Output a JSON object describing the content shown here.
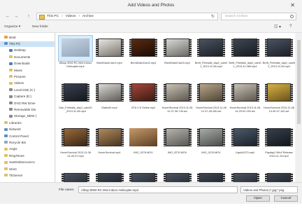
{
  "window": {
    "title": "Add Videos and Photos"
  },
  "nav": {
    "back": "←",
    "forward": "→",
    "up": "↑",
    "crumbs": [
      "This PC",
      "›",
      "Videos",
      "›",
      "Archive"
    ],
    "refresh": "↻",
    "search_placeholder": "Search Archive"
  },
  "toolbar": {
    "organize": "Organize ▾",
    "new_folder": "New folder",
    "view": "☷ ▾",
    "help": "?"
  },
  "tree": [
    {
      "label": "Brett",
      "indent": 0,
      "color": "#d9a441"
    },
    {
      "label": "This PC",
      "indent": 0,
      "color": "#5d8fc9",
      "selected": true
    },
    {
      "label": "Desktop",
      "indent": 1,
      "color": "#4b7fc0"
    },
    {
      "label": "Documents",
      "indent": 1,
      "color": "#e0c06a"
    },
    {
      "label": "Downloads",
      "indent": 1,
      "color": "#4b7fc0"
    },
    {
      "label": "Music",
      "indent": 1,
      "color": "#e0c06a"
    },
    {
      "label": "Pictures",
      "indent": 1,
      "color": "#e0c06a"
    },
    {
      "label": "Videos",
      "indent": 1,
      "color": "#e0c06a"
    },
    {
      "label": "Local Disk (C:)",
      "indent": 1,
      "color": "#8a8a8a"
    },
    {
      "label": "Capture (E:)",
      "indent": 1,
      "color": "#8a8a8a"
    },
    {
      "label": "DVD RW Drive",
      "indent": 1,
      "color": "#8a8a8a"
    },
    {
      "label": "Removable Dis",
      "indent": 1,
      "color": "#8a8a8a"
    },
    {
      "label": "Storage_NEW (",
      "indent": 1,
      "color": "#8a8a8a"
    },
    {
      "label": "Libraries",
      "indent": 0,
      "color": "#e0c06a"
    },
    {
      "label": "Network",
      "indent": 0,
      "color": "#5d8fc9"
    },
    {
      "label": "Control Panel",
      "indent": 0,
      "color": "#5d8fc9"
    },
    {
      "label": "Recycle Bin",
      "indent": 0,
      "color": "#8aa7c7"
    },
    {
      "label": "Aegis",
      "indent": 0,
      "color": "#e0c06a"
    },
    {
      "label": "RingTones",
      "indent": 0,
      "color": "#e0c06a"
    },
    {
      "label": "SanDiskSecureAc",
      "indent": 0,
      "color": "#e0c06a"
    },
    {
      "label": "Store",
      "indent": 0,
      "color": "#e0c06a"
    },
    {
      "label": "TEServer",
      "indent": 0,
      "color": "#e0c06a"
    }
  ],
  "files": [
    {
      "name": "Allsop 9000 RC Mini Indoor Helicopter.mp4",
      "a": "#c7d5e3",
      "b": "#8fa3b8",
      "selected": true,
      "film": false
    },
    {
      "name": "BrentDashCam1.mp4",
      "a": "#e8e6e2",
      "b": "#7a746c",
      "film": true
    },
    {
      "name": "BrentDashCam2.mp4",
      "a": "#5a2a10",
      "b": "#1c0c05",
      "film": true
    },
    {
      "name": "BrentDashCam3.mp4",
      "a": "#d9d8d4",
      "b": "#6b6a66",
      "film": true
    },
    {
      "name": "Brett_Fireballs_day2_cam01_2013-11-08.mp4",
      "a": "#4a5360",
      "b": "#1c2028",
      "film": true
    },
    {
      "name": "Brett_Fireballs_day2_cam01_2013-11-08b.mp4",
      "a": "#3e4652",
      "b": "#181c22",
      "film": true
    },
    {
      "name": "Brett_Fireballs_day2_cam02_2013-11-08.mp4",
      "a": "#4a5360",
      "b": "#1c2028",
      "film": true
    },
    {
      "name": "Dan_Fireballs_day1_cam02_2013-11-08.mp4",
      "a": "#3a4250",
      "b": "#14181e",
      "film": true
    },
    {
      "name": "DiabloIII.mp4",
      "a": "#dcdad6",
      "b": "#5f5c58",
      "film": true
    },
    {
      "name": "GTA V 8 Online.mp4",
      "a": "#a6473a",
      "b": "#3a1a14",
      "film": true
    },
    {
      "name": "HoverSurvival 2013-11-08 12-07-36-740.avi",
      "a": "#c9c2b6",
      "b": "#5e574e",
      "film": true
    },
    {
      "name": "HoverSurvival 2013-11-08 12-37-28-160.avi",
      "a": "#b8a68a",
      "b": "#4f4536",
      "film": true
    },
    {
      "name": "HoverSurvival 2013-11-08 14-29-02-152.avi",
      "a": "#c9c2b6",
      "b": "#5e574e",
      "film": true
    },
    {
      "name": "HoverSurvival 2013-11-08 14-40-07-152.avi",
      "a": "#d8b24a",
      "b": "#6a5318",
      "film": true
    },
    {
      "name": "HoverSurvival 2013-11-08 14-49-37.mp4",
      "a": "#9a6a3a",
      "b": "#3a2614",
      "film": true
    },
    {
      "name": "HoverSurvival.mp4",
      "a": "#b08a5c",
      "b": "#4a3620",
      "film": true
    },
    {
      "name": "IMG_0276.MOV",
      "a": "#c69a6a",
      "b": "#5c3e22",
      "film": false
    },
    {
      "name": "IMG_0276.MOV",
      "a": "#b7b4ae",
      "b": "#5a5852",
      "film": true
    },
    {
      "name": "IMG_0276.MOV",
      "a": "#a8aca8",
      "b": "#4a4e4a",
      "film": true
    },
    {
      "name": "Liquid1370.mp4",
      "a": "#4a5a6a",
      "b": "#1a222a",
      "film": true
    },
    {
      "name": "Payday2 Win2 Release 2013-11-15.mp4",
      "a": "#38404c",
      "b": "#12161c",
      "film": true
    },
    {
      "name": "",
      "a": "#4a5360",
      "b": "#1c2028",
      "film": true
    },
    {
      "name": "",
      "a": "#3e4652",
      "b": "#181c22",
      "film": true
    },
    {
      "name": "",
      "a": "#4a5360",
      "b": "#1c2028",
      "film": true
    },
    {
      "name": "",
      "a": "#4a5360",
      "b": "#1c2028",
      "film": true
    },
    {
      "name": "",
      "a": "#3e4652",
      "b": "#181c22",
      "film": true
    },
    {
      "name": "",
      "a": "#4a5360",
      "b": "#1c2028",
      "film": true
    },
    {
      "name": "",
      "a": "#3e4652",
      "b": "#181c22",
      "film": true
    }
  ],
  "bottom": {
    "file_name_label": "File name:",
    "file_name_value": "Allsop 9000 RC Mini Indoor Helicopter.mp4",
    "file_type": "Videos and Photos (*.jpg;*.png",
    "open": "Open",
    "cancel": "Cancel"
  }
}
